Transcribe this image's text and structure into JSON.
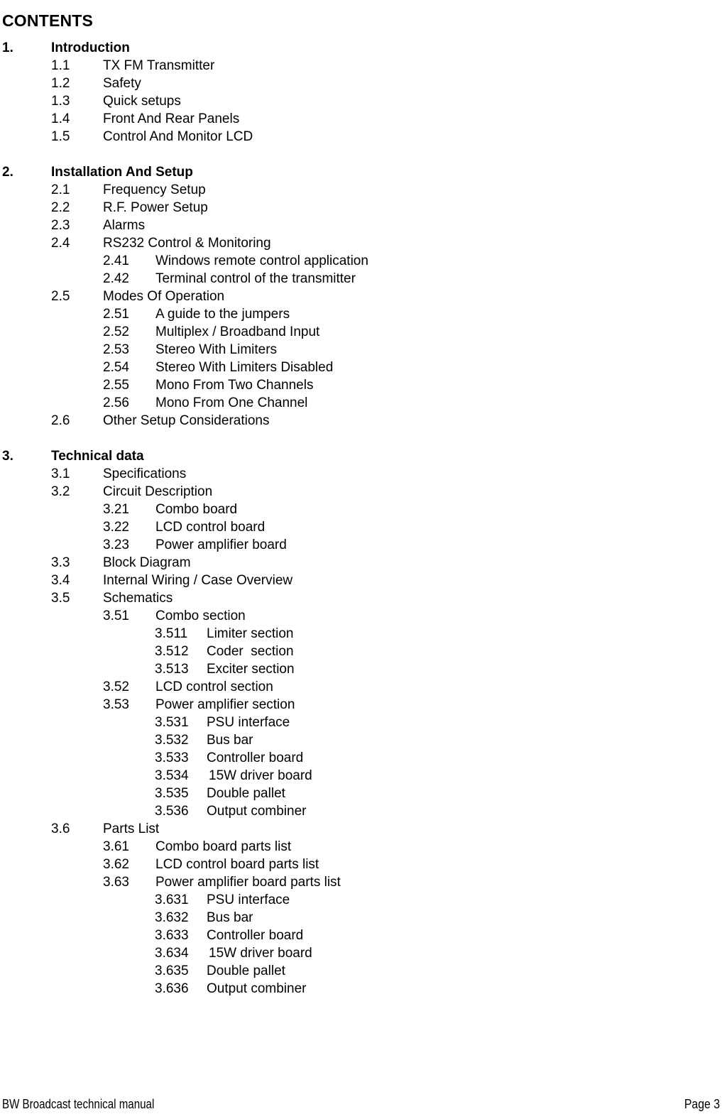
{
  "document": {
    "title": "CONTENTS"
  },
  "toc": {
    "entries": [
      {
        "level": 1,
        "num": "1.",
        "text": "Introduction"
      },
      {
        "level": 2,
        "num": "1.1",
        "text": "TX FM Transmitter"
      },
      {
        "level": 2,
        "num": "1.2",
        "text": "Safety"
      },
      {
        "level": 2,
        "num": "1.3",
        "text": "Quick setups"
      },
      {
        "level": 2,
        "num": "1.4",
        "text": "Front And Rear Panels"
      },
      {
        "level": 2,
        "num": "1.5",
        "text": "Control And Monitor LCD"
      },
      {
        "level": 0,
        "num": "",
        "text": ""
      },
      {
        "level": 1,
        "num": "2.",
        "text": "Installation And Setup"
      },
      {
        "level": 2,
        "num": "2.1",
        "text": "Frequency Setup"
      },
      {
        "level": 2,
        "num": "2.2",
        "text": "R.F. Power Setup"
      },
      {
        "level": 2,
        "num": "2.3",
        "text": "Alarms"
      },
      {
        "level": 2,
        "num": "2.4",
        "text": "RS232 Control & Monitoring"
      },
      {
        "level": 3,
        "num": "2.41",
        "text": "Windows remote control application"
      },
      {
        "level": 3,
        "num": "2.42",
        "text": "Terminal control of the transmitter"
      },
      {
        "level": 2,
        "num": "2.5",
        "text": "Modes Of Operation"
      },
      {
        "level": 3,
        "num": "2.51",
        "text": "A guide to the jumpers"
      },
      {
        "level": 3,
        "num": "2.52",
        "text": "Multiplex / Broadband Input"
      },
      {
        "level": 3,
        "num": "2.53",
        "text": "Stereo With Limiters"
      },
      {
        "level": 3,
        "num": "2.54",
        "text": "Stereo With Limiters Disabled"
      },
      {
        "level": 3,
        "num": "2.55",
        "text": "Mono From Two Channels"
      },
      {
        "level": 3,
        "num": "2.56",
        "text": "Mono From One Channel"
      },
      {
        "level": 2,
        "num": "2.6",
        "text": "Other Setup Considerations"
      },
      {
        "level": 0,
        "num": "",
        "text": ""
      },
      {
        "level": 1,
        "num": "3.",
        "text": "Technical data"
      },
      {
        "level": 2,
        "num": "3.1",
        "text": "Specifications"
      },
      {
        "level": 2,
        "num": "3.2",
        "text": "Circuit Description"
      },
      {
        "level": 3,
        "num": "3.21",
        "text": "Combo board"
      },
      {
        "level": 3,
        "num": "3.22",
        "text": "LCD control board"
      },
      {
        "level": 3,
        "num": "3.23",
        "text": "Power amplifier board"
      },
      {
        "level": 2,
        "num": "3.3",
        "text": "Block Diagram"
      },
      {
        "level": 2,
        "num": "3.4",
        "text": "Internal Wiring / Case Overview"
      },
      {
        "level": 2,
        "num": "3.5",
        "text": "Schematics"
      },
      {
        "level": 3,
        "num": "3.51",
        "text": "Combo section"
      },
      {
        "level": 4,
        "num": "3.511",
        "text": "Limiter section"
      },
      {
        "level": 4,
        "num": "3.512",
        "text": "Coder  section"
      },
      {
        "level": 4,
        "num": "3.513",
        "text": "Exciter section"
      },
      {
        "level": 3,
        "num": "3.52",
        "text": "LCD control section"
      },
      {
        "level": 3,
        "num": "3.53",
        "text": "Power amplifier section"
      },
      {
        "level": 4,
        "num": "3.531",
        "text": "PSU interface"
      },
      {
        "level": 4,
        "num": "3.532",
        "text": "Bus bar"
      },
      {
        "level": 4,
        "num": "3.533",
        "text": "Controller board"
      },
      {
        "level": 4,
        "num": "3.534",
        "text": "15W driver board",
        "nudge": true
      },
      {
        "level": 4,
        "num": "3.535",
        "text": "Double pallet"
      },
      {
        "level": 4,
        "num": "3.536",
        "text": "Output combiner"
      },
      {
        "level": 2,
        "num": "3.6",
        "text": "Parts List"
      },
      {
        "level": 3,
        "num": "3.61",
        "text": "Combo board parts list"
      },
      {
        "level": 3,
        "num": "3.62",
        "text": "LCD control board parts list"
      },
      {
        "level": 3,
        "num": "3.63",
        "text": "Power amplifier board parts list"
      },
      {
        "level": 4,
        "num": "3.631",
        "text": "PSU interface"
      },
      {
        "level": 4,
        "num": "3.632",
        "text": "Bus bar"
      },
      {
        "level": 4,
        "num": "3.633",
        "text": "Controller board"
      },
      {
        "level": 4,
        "num": "3.634",
        "text": "15W driver board",
        "nudge": true
      },
      {
        "level": 4,
        "num": "3.635",
        "text": "Double pallet"
      },
      {
        "level": 4,
        "num": "3.636",
        "text": "Output combiner"
      }
    ]
  },
  "footer": {
    "left": "BW Broadcast technical manual",
    "right": "Page 3"
  }
}
